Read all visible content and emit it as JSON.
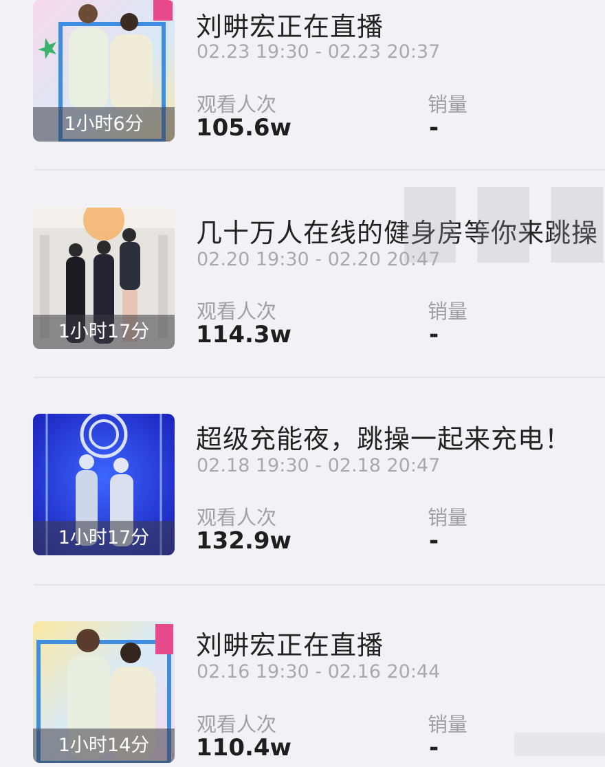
{
  "streams": [
    {
      "title": "刘畊宏正在直播",
      "time_range": "02.23 19:30 - 02.23 20:37",
      "duration": "1小时6分",
      "views_label": "观看人次",
      "views": "105.6w",
      "sales_label": "销量",
      "sales": "-",
      "thumb_theme": "pastel-studio"
    },
    {
      "title": "几十万人在线的健身房等你来跳操",
      "time_range": "02.20 19:30 - 02.20 20:47",
      "duration": "1小时17分",
      "views_label": "观看人次",
      "views": "114.3w",
      "sales_label": "销量",
      "sales": "-",
      "thumb_theme": "white-room"
    },
    {
      "title": "超级充能夜，跳操一起来充电！",
      "time_range": "02.18 19:30 - 02.18 20:47",
      "duration": "1小时17分",
      "views_label": "观看人次",
      "views": "132.9w",
      "sales_label": "销量",
      "sales": "-",
      "thumb_theme": "blue-stage"
    },
    {
      "title": "刘畊宏正在直播",
      "time_range": "02.16 19:30 - 02.16 20:44",
      "duration": "1小时14分",
      "views_label": "观看人次",
      "views": "110.4w",
      "sales_label": "销量",
      "sales": "-",
      "thumb_theme": "pastel-studio"
    }
  ],
  "colors": {
    "background": "#f2f1f6",
    "title": "#222222",
    "secondary_text": "#a8a8ad",
    "value_text": "#1e1e1e"
  }
}
